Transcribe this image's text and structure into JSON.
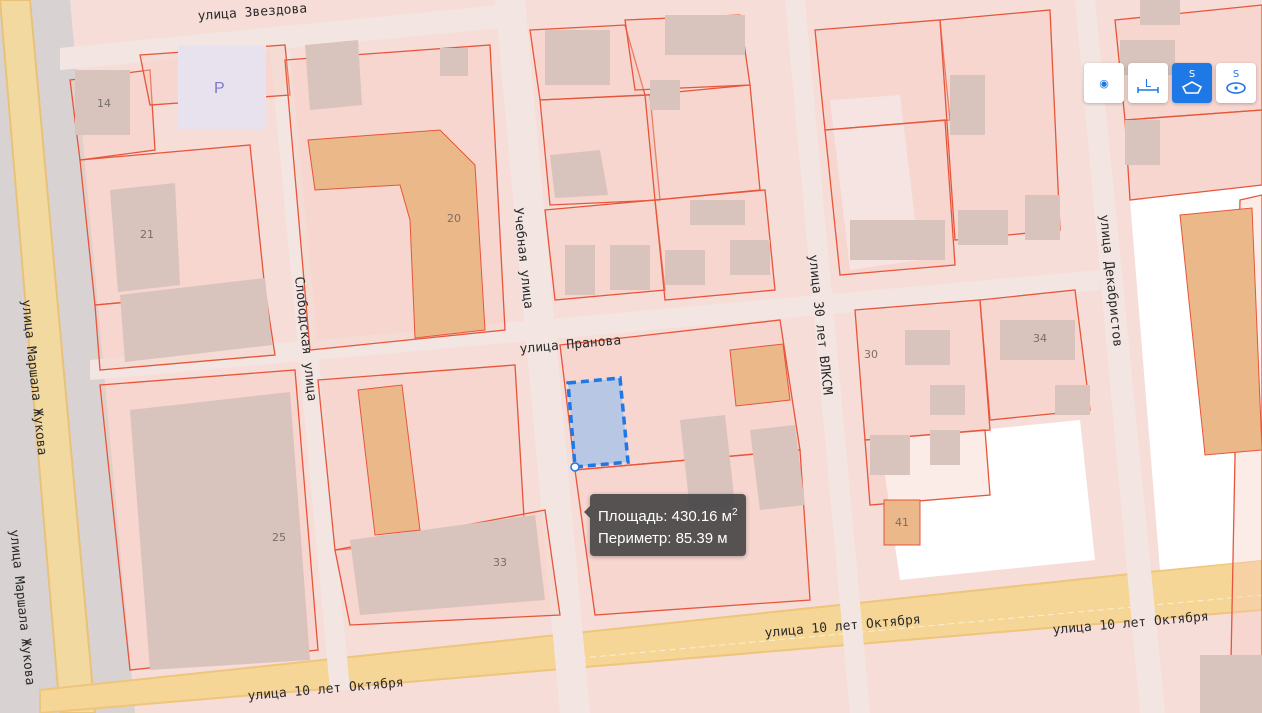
{
  "streets": {
    "zvezdova": "улица Звездова",
    "uchebnaya": "Учебная улица",
    "pranova": "улица Пранова",
    "slobodskaya": "Слободская улица",
    "vlksm": "улица 30 лет ВЛКСМ",
    "dekabristov": "улица Декабристов",
    "oktyabrya_left": "улица 10 лет Октября",
    "oktyabrya_mid": "улица 10 лет Октября",
    "oktyabrya_right": "улица 10 лет Октября",
    "zhukova_1": "улица Маршала Жукова",
    "zhukova_2": "улица Маршала Жукова"
  },
  "house_numbers": [
    "14",
    "21",
    "20",
    "25",
    "33",
    "30",
    "34",
    "41"
  ],
  "parking_label": "P",
  "toolbar": {
    "tools": [
      {
        "name": "point",
        "glyph": "◉",
        "active": false
      },
      {
        "name": "length",
        "glyph": "L",
        "active": false
      },
      {
        "name": "area",
        "glyph": "S",
        "active": true
      },
      {
        "name": "area-3d",
        "glyph": "S",
        "active": false
      }
    ]
  },
  "measurement": {
    "area_label": "Площадь:",
    "area_value": "430.16 м",
    "area_unit_sup": "2",
    "perimeter_label": "Периметр:",
    "perimeter_value": "85.39 м"
  },
  "colors": {
    "parcel_stroke": "#e8553a",
    "selection": "#1e78e6",
    "road": "#f7d89a"
  }
}
